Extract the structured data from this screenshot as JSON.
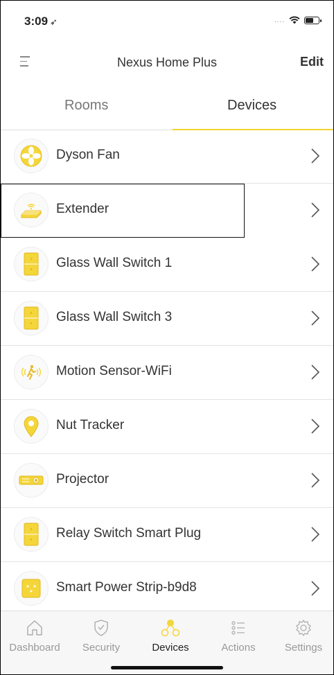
{
  "status_bar": {
    "time": "3:09",
    "location_glyph": "➶",
    "signal_dots": "....",
    "wifi_icon": "wifi-icon",
    "battery_icon": "battery-icon",
    "battery_level_fraction": 0.55
  },
  "header": {
    "title": "Nexus Home Plus",
    "edit_label": "Edit",
    "menu_icon": "hamburger-menu-icon"
  },
  "tabs": {
    "rooms": "Rooms",
    "devices": "Devices",
    "active": "devices"
  },
  "devices": [
    {
      "name": "Dyson Fan",
      "icon": "fan-icon"
    },
    {
      "name": "Extender",
      "icon": "extender-icon",
      "highlighted": true
    },
    {
      "name": "Glass Wall Switch 1",
      "icon": "wall-switch-icon"
    },
    {
      "name": "Glass Wall Switch 3",
      "icon": "wall-switch-icon"
    },
    {
      "name": "Motion Sensor-WiFi",
      "icon": "motion-sensor-icon"
    },
    {
      "name": "Nut Tracker",
      "icon": "location-pin-icon"
    },
    {
      "name": "Projector",
      "icon": "projector-icon"
    },
    {
      "name": "Relay Switch Smart Plug",
      "icon": "relay-switch-icon"
    },
    {
      "name": "Smart Power Strip-b9d8",
      "icon": "power-strip-icon"
    }
  ],
  "tab_bar": [
    {
      "label": "Dashboard",
      "icon": "home-icon"
    },
    {
      "label": "Security",
      "icon": "shield-icon"
    },
    {
      "label": "Devices",
      "icon": "devices-icon",
      "active": true
    },
    {
      "label": "Actions",
      "icon": "list-icon"
    },
    {
      "label": "Settings",
      "icon": "gear-icon"
    }
  ],
  "colors": {
    "accent": "#f2d42c",
    "icon_yellow": "#f5d63a",
    "text": "#333333",
    "muted": "#999999"
  }
}
